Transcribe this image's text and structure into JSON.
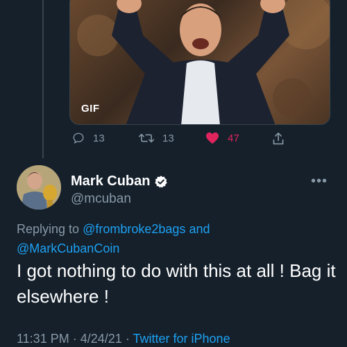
{
  "media": {
    "badge": "GIF"
  },
  "actions": {
    "reply_count": "13",
    "retweet_count": "13",
    "like_count": "47",
    "like_color": "#e0245e"
  },
  "author": {
    "display_name": "Mark Cuban",
    "handle": "@mcuban",
    "verified_icon": "verified-badge-icon",
    "more_label": "•••"
  },
  "replying": {
    "prefix": "Replying to",
    "user1": "@frombroke2bags",
    "conjunction": "and",
    "user2": "@MarkCubanCoin"
  },
  "tweet": {
    "text": "I got nothing to do with this at all ! Bag it elsewhere !"
  },
  "meta": {
    "time": "11:31 PM",
    "separator": "·",
    "date": "4/24/21",
    "source": "Twitter for iPhone"
  },
  "colors": {
    "background": "#15202b",
    "secondary_text": "#8899a6",
    "link": "#1da1f2"
  }
}
